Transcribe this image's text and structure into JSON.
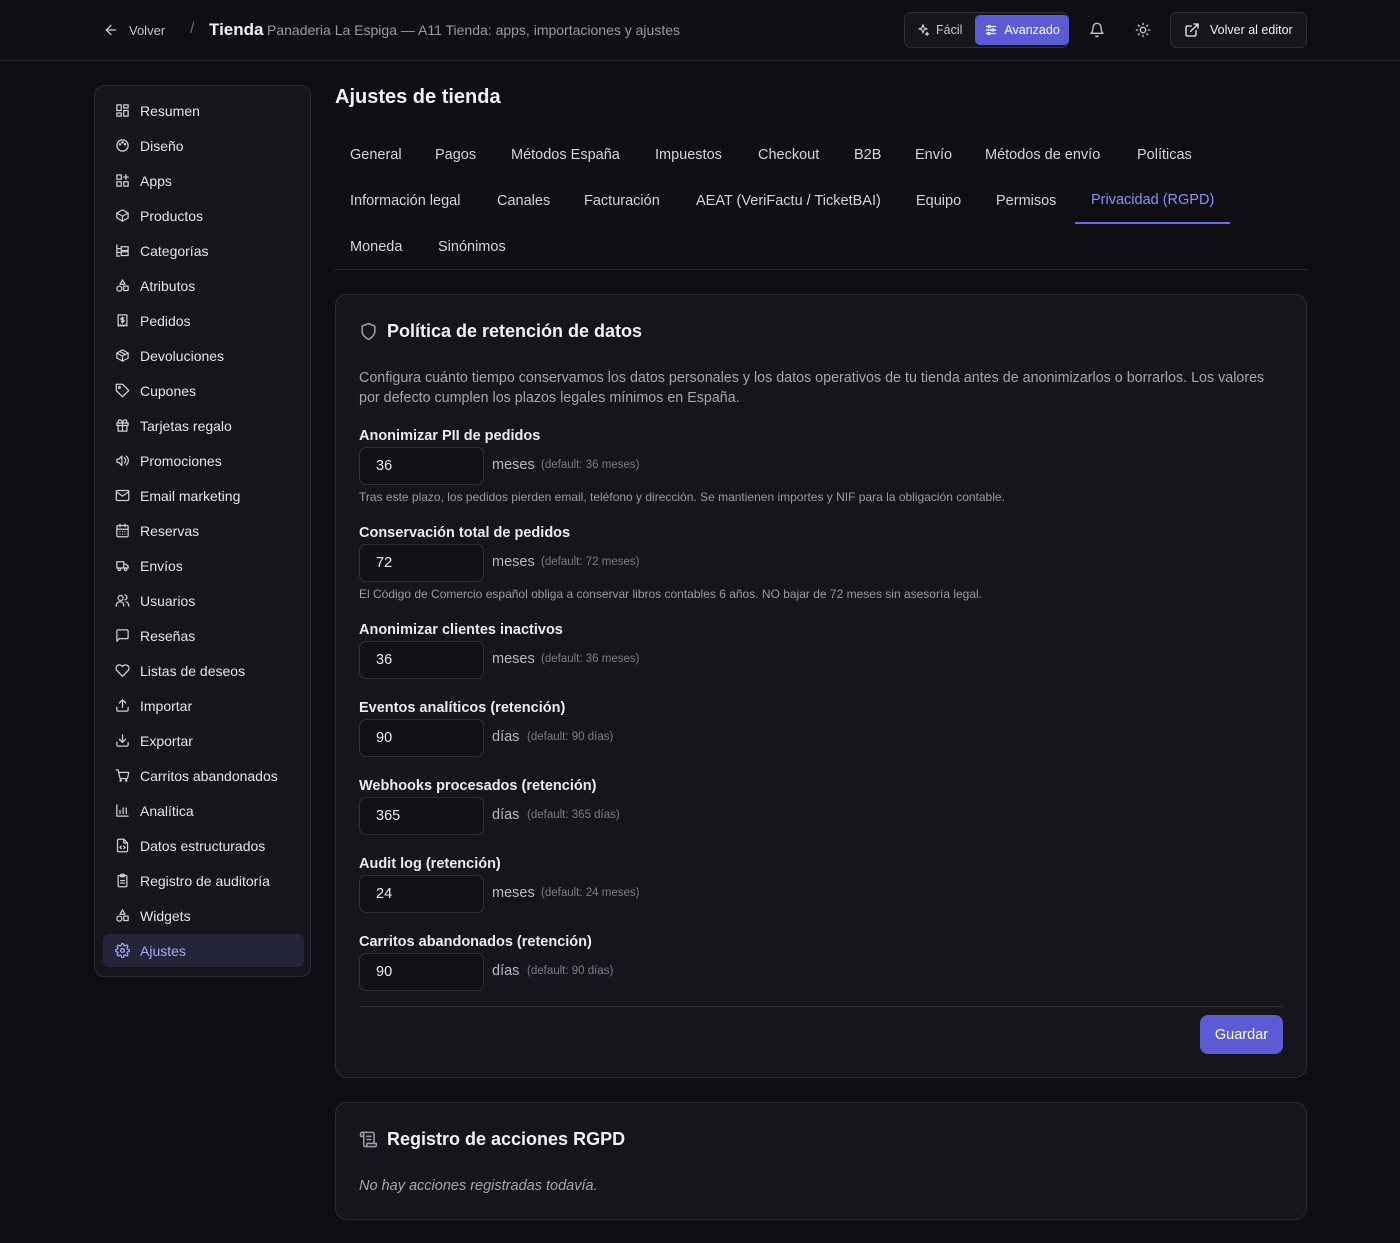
{
  "header": {
    "back_label": "Volver",
    "separator": "/",
    "title": "Tienda",
    "subtitle": "Panaderia La Espiga — A11 Tienda: apps, importaciones y ajustes",
    "mode_easy": "Fácil",
    "mode_advanced": "Avanzado",
    "active_mode": "Avanzado",
    "editor_button": "Volver al editor"
  },
  "sidebar": {
    "items": [
      {
        "label": "Resumen",
        "icon": "grid-icon"
      },
      {
        "label": "Diseño",
        "icon": "palette-icon"
      },
      {
        "label": "Apps",
        "icon": "apps-icon"
      },
      {
        "label": "Productos",
        "icon": "box-icon"
      },
      {
        "label": "Categorías",
        "icon": "tree-icon"
      },
      {
        "label": "Atributos",
        "icon": "shapes-icon"
      },
      {
        "label": "Pedidos",
        "icon": "receipt-icon"
      },
      {
        "label": "Devoluciones",
        "icon": "package-return-icon"
      },
      {
        "label": "Cupones",
        "icon": "tag-icon"
      },
      {
        "label": "Tarjetas regalo",
        "icon": "gift-icon"
      },
      {
        "label": "Promociones",
        "icon": "megaphone-icon"
      },
      {
        "label": "Email marketing",
        "icon": "mail-icon"
      },
      {
        "label": "Reservas",
        "icon": "calendar-icon"
      },
      {
        "label": "Envíos",
        "icon": "truck-icon"
      },
      {
        "label": "Usuarios",
        "icon": "users-icon"
      },
      {
        "label": "Reseñas",
        "icon": "message-icon"
      },
      {
        "label": "Listas de deseos",
        "icon": "heart-icon"
      },
      {
        "label": "Importar",
        "icon": "upload-icon"
      },
      {
        "label": "Exportar",
        "icon": "download-icon"
      },
      {
        "label": "Carritos abandonados",
        "icon": "cart-icon"
      },
      {
        "label": "Analítica",
        "icon": "bar-chart-icon"
      },
      {
        "label": "Datos estructurados",
        "icon": "file-code-icon"
      },
      {
        "label": "Registro de auditoría",
        "icon": "clipboard-icon"
      },
      {
        "label": "Widgets",
        "icon": "shapes-icon"
      },
      {
        "label": "Ajustes",
        "icon": "gear-icon"
      }
    ],
    "active": "Ajustes"
  },
  "main": {
    "title": "Ajustes de tienda",
    "tabs": [
      "General",
      "Pagos",
      "Métodos España",
      "Impuestos",
      "Checkout",
      "B2B",
      "Envío",
      "Métodos de envío",
      "Políticas",
      "Información legal",
      "Canales",
      "Facturación",
      "AEAT (VeriFactu / TicketBAI)",
      "Equipo",
      "Permisos",
      "Privacidad (RGPD)",
      "Moneda",
      "Sinónimos"
    ],
    "active_tab": "Privacidad (RGPD)"
  },
  "retention": {
    "title": "Política de retención de datos",
    "description": "Configura cuánto tiempo conservamos los datos personales y los datos operativos de tu tienda antes de anonimizarlos o borrarlos. Los valores por defecto cumplen los plazos legales mínimos en España.",
    "fields": [
      {
        "label": "Anonimizar PII de pedidos",
        "value": "36",
        "unit": "meses",
        "default": "(default: 36 meses)",
        "hint": "Tras este plazo, los pedidos pierden email, teléfono y dirección. Se mantienen importes y NIF para la obligación contable."
      },
      {
        "label": "Conservación total de pedidos",
        "value": "72",
        "unit": "meses",
        "default": "(default: 72 meses)",
        "hint": "El Código de Comercio español obliga a conservar libros contables 6 años. NO bajar de 72 meses sin asesoría legal."
      },
      {
        "label": "Anonimizar clientes inactivos",
        "value": "36",
        "unit": "meses",
        "default": "(default: 36 meses)",
        "hint": ""
      },
      {
        "label": "Eventos analíticos (retención)",
        "value": "90",
        "unit": "días",
        "default": "(default: 90 días)",
        "hint": ""
      },
      {
        "label": "Webhooks procesados (retención)",
        "value": "365",
        "unit": "días",
        "default": "(default: 365 días)",
        "hint": ""
      },
      {
        "label": "Audit log (retención)",
        "value": "24",
        "unit": "meses",
        "default": "(default: 24 meses)",
        "hint": ""
      },
      {
        "label": "Carritos abandonados (retención)",
        "value": "90",
        "unit": "días",
        "default": "(default: 90 días)",
        "hint": ""
      }
    ],
    "save_label": "Guardar"
  },
  "rgpd_log": {
    "title": "Registro de acciones RGPD",
    "empty_text": "No hay acciones registradas todavía."
  },
  "colors": {
    "background": "#0e0e13",
    "card": "#15151b",
    "accent": "#5b5bd6",
    "active_tab_text": "#8f8fff"
  }
}
